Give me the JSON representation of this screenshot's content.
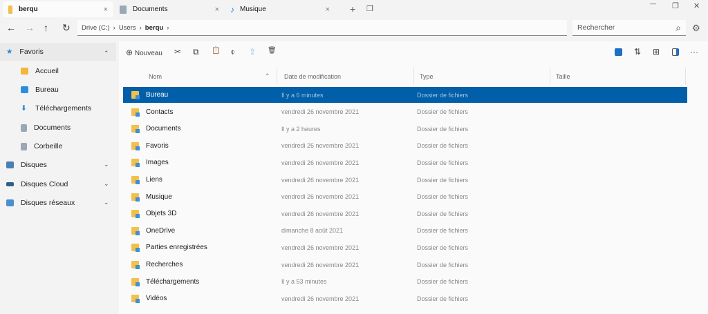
{
  "tabs": [
    {
      "label": "berqu",
      "color": "#f2c04b"
    },
    {
      "label": "Documents",
      "color": "#9aa7b5"
    },
    {
      "label": "Musique",
      "color": "#2a86d8"
    }
  ],
  "icons": {
    "close": "×",
    "new_tab": "+",
    "restore": "❐",
    "minimize": "—",
    "maximize": "❐",
    "win_close": "✕",
    "back": "←",
    "forward": "→",
    "up": "↑",
    "refresh": "↻",
    "search": "⌕",
    "settings": "⚙",
    "chevron": "›",
    "expand": "⌄",
    "collapse": "⌃"
  },
  "breadcrumb": [
    "Drive (C:)",
    "Users",
    "berqu"
  ],
  "search_placeholder": "Rechercher",
  "sidebar": {
    "favoris": "Favoris",
    "items": [
      {
        "label": "Accueil",
        "color": "#f2b63a"
      },
      {
        "label": "Bureau",
        "color": "#2a8ee0"
      },
      {
        "label": "Téléchargements",
        "color": "#2a86d8"
      },
      {
        "label": "Documents",
        "color": "#9aa7b5"
      },
      {
        "label": "Corbeille",
        "color": "#9aa7b5"
      }
    ],
    "groups": [
      {
        "label": "Disques",
        "color": "#4a7fb5"
      },
      {
        "label": "Disques Cloud",
        "color": "#2f5f8a"
      },
      {
        "label": "Disques réseaux",
        "color": "#4a8fd0"
      }
    ]
  },
  "toolbar": {
    "new": "Nouveau",
    "new_icon": "⊕",
    "cut": "✂",
    "copy": "⧉",
    "paste": "📋",
    "rename": "⌽",
    "share": "⇪",
    "delete": "🗑",
    "more": "···",
    "sort": "⇅",
    "layout": "⊞"
  },
  "columns": {
    "name": "Nom",
    "date": "Date de modification",
    "type": "Type",
    "size": "Taille",
    "sort_icon": "⌃"
  },
  "accent": "#005fa8",
  "files": [
    {
      "name": "Bureau",
      "date": "Il y a 6 minutes",
      "type": "Dossier de fichiers",
      "selected": true
    },
    {
      "name": "Contacts",
      "date": "vendredi 26 novembre 2021",
      "type": "Dossier de fichiers"
    },
    {
      "name": "Documents",
      "date": "Il y a 2 heures",
      "type": "Dossier de fichiers"
    },
    {
      "name": "Favoris",
      "date": "vendredi 26 novembre 2021",
      "type": "Dossier de fichiers"
    },
    {
      "name": "Images",
      "date": "vendredi 26 novembre 2021",
      "type": "Dossier de fichiers"
    },
    {
      "name": "Liens",
      "date": "vendredi 26 novembre 2021",
      "type": "Dossier de fichiers"
    },
    {
      "name": "Musique",
      "date": "vendredi 26 novembre 2021",
      "type": "Dossier de fichiers"
    },
    {
      "name": "Objets 3D",
      "date": "vendredi 26 novembre 2021",
      "type": "Dossier de fichiers"
    },
    {
      "name": "OneDrive",
      "date": "dimanche 8 août 2021",
      "type": "Dossier de fichiers"
    },
    {
      "name": "Parties enregistrées",
      "date": "vendredi 26 novembre 2021",
      "type": "Dossier de fichiers"
    },
    {
      "name": "Recherches",
      "date": "vendredi 26 novembre 2021",
      "type": "Dossier de fichiers"
    },
    {
      "name": "Téléchargements",
      "date": "Il y a 53 minutes",
      "type": "Dossier de fichiers"
    },
    {
      "name": "Vidéos",
      "date": "vendredi 26 novembre 2021",
      "type": "Dossier de fichiers"
    }
  ]
}
